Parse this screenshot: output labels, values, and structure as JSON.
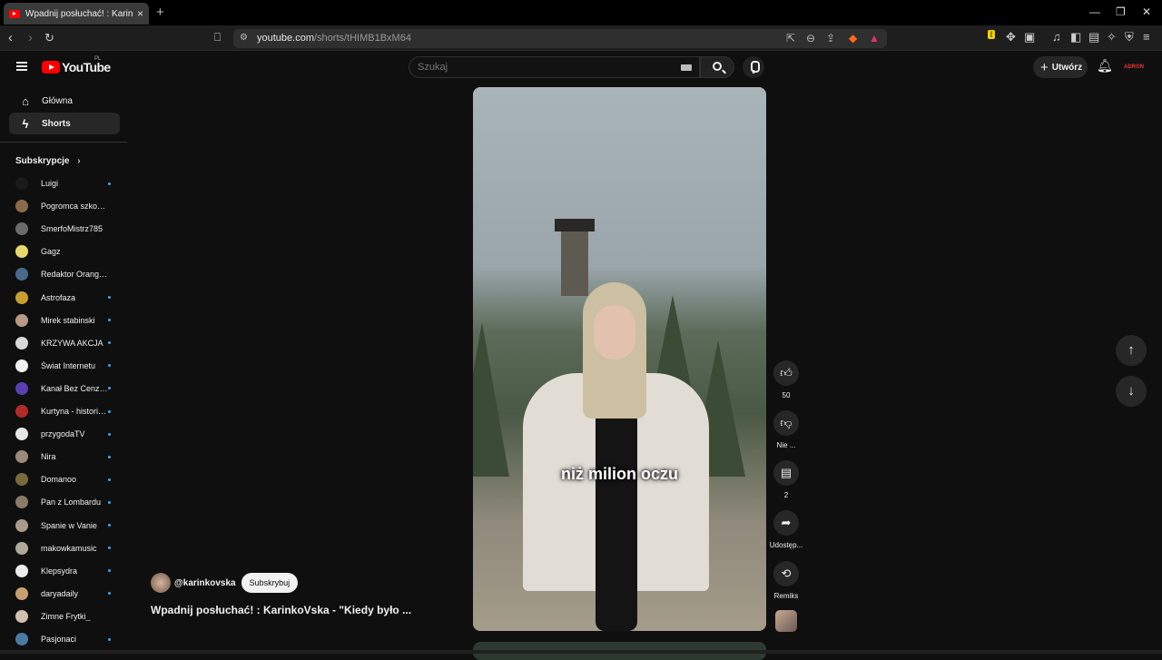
{
  "browser": {
    "tab_title": "Wpadnij posłuchać! : Karinko",
    "new_tab": "+",
    "url_host": "youtube.com",
    "url_path": "/shorts/tHIMB1BxM64"
  },
  "header": {
    "logo": "YouTube",
    "country": "PL",
    "search_placeholder": "Szukaj",
    "create_label": "Utwórz",
    "avatar_text": "ADRON"
  },
  "sidebar": {
    "main": [
      {
        "label": "Główna",
        "icon": "home-icon"
      },
      {
        "label": "Shorts",
        "icon": "shorts-icon"
      }
    ],
    "subscriptions_heading": "Subskrypcje",
    "subscriptions": [
      {
        "name": "Luigi",
        "dot": true,
        "color": "#1a1a1a"
      },
      {
        "name": "Pogromca szkodni...",
        "dot": false,
        "color": "#8a6a4a"
      },
      {
        "name": "SmerfoMistrz785",
        "dot": false,
        "color": "#6b6b6b"
      },
      {
        "name": "Gagz",
        "dot": false,
        "color": "#e8d96a"
      },
      {
        "name": "Redaktor Orangutan",
        "dot": false,
        "color": "#4a6a8a"
      },
      {
        "name": "Astrofaza",
        "dot": true,
        "color": "#c8a030"
      },
      {
        "name": "Mirek stabinski",
        "dot": true,
        "color": "#b89a86"
      },
      {
        "name": "KRZYWA AKCJA",
        "dot": true,
        "color": "#d9d9d9"
      },
      {
        "name": "Świat Internetu",
        "dot": true,
        "color": "#f2f2f2"
      },
      {
        "name": "Kanał Bez Cenzu...",
        "dot": true,
        "color": "#5a3fb0"
      },
      {
        "name": "Kurtyna - historie...",
        "dot": true,
        "color": "#b02a2a"
      },
      {
        "name": "przygodaTV",
        "dot": true,
        "color": "#e6e6e6"
      },
      {
        "name": "Nira",
        "dot": true,
        "color": "#9a8a7a"
      },
      {
        "name": "Domanoo",
        "dot": true,
        "color": "#7a6a3a"
      },
      {
        "name": "Pan z Lombardu",
        "dot": true,
        "color": "#8a7a6a"
      },
      {
        "name": "Spanie w Vanie",
        "dot": true,
        "color": "#aa9a8a"
      },
      {
        "name": "makowkamusic",
        "dot": true,
        "color": "#b0a898"
      },
      {
        "name": "Klepsydra",
        "dot": true,
        "color": "#ececec"
      },
      {
        "name": "daryadaily",
        "dot": true,
        "color": "#c8a070"
      },
      {
        "name": "Zimne Frytki_",
        "dot": false,
        "color": "#d0c0b0"
      },
      {
        "name": "Pasjonaci",
        "dot": true,
        "color": "#4a7aa0"
      }
    ]
  },
  "video": {
    "caption": "niż milion oczu",
    "channel": "@karinkovska",
    "subscribe_label": "Subskrybuj",
    "title": "Wpadnij posłuchać!  : KarinkoVska - \"Kiedy było ..."
  },
  "actions": {
    "like_count": "50",
    "dislike_label": "Nie ...",
    "comment_count": "2",
    "share_label": "Udostęp...",
    "remix_label": "Remiks"
  }
}
